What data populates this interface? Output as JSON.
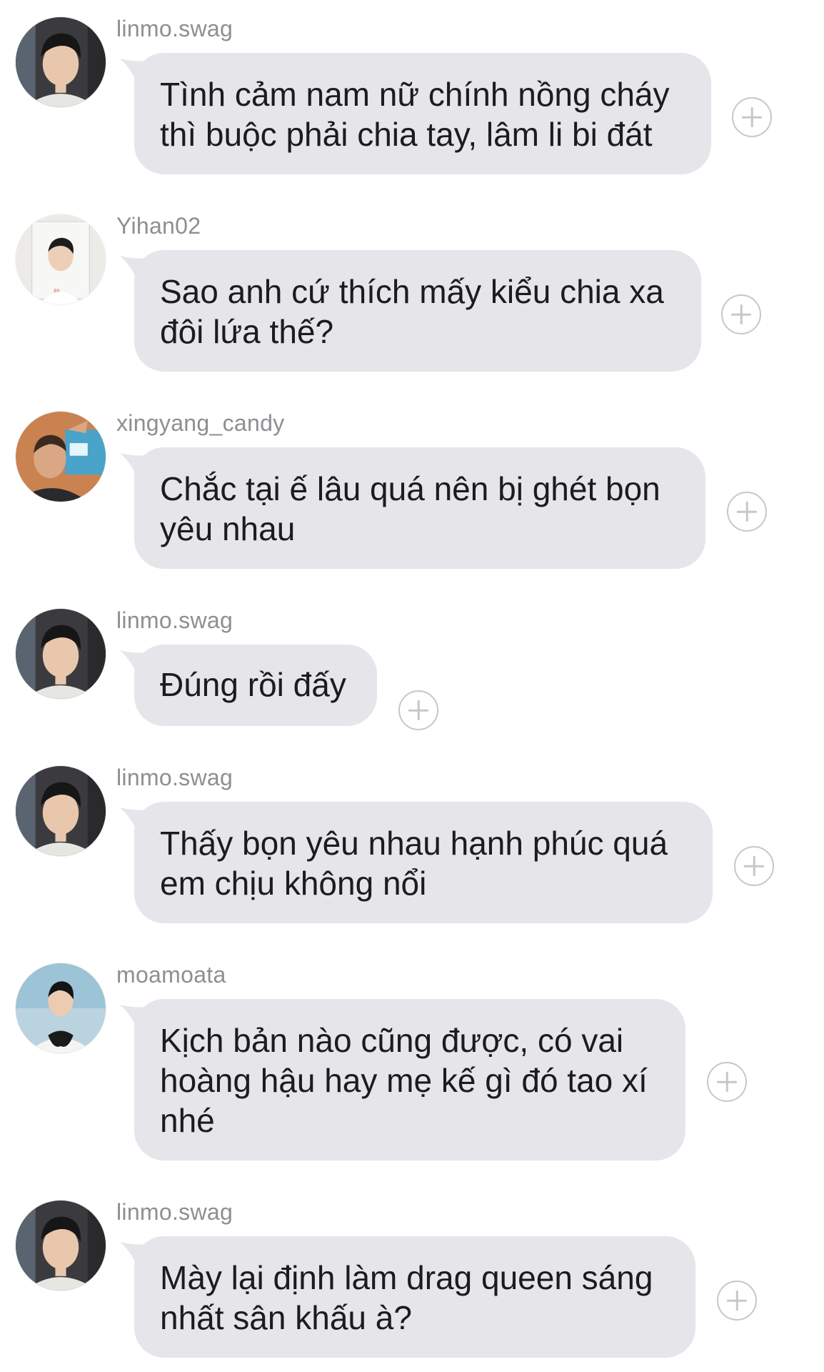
{
  "colors": {
    "bubble": "#e5e5ea",
    "username": "#8e8e93",
    "text": "#1c1c1e",
    "react_icon": "#c7c7cc"
  },
  "messages": [
    {
      "username": "linmo.swag",
      "text": "Tình cảm nam nữ chính nồng cháy thì buộc phải chia tay, lâm li bi đát",
      "avatar": "avatar-linmo"
    },
    {
      "username": "Yihan02",
      "text": "Sao anh cứ thích mấy kiểu chia xa đôi lứa thế?",
      "avatar": "avatar-yihan"
    },
    {
      "username": "xingyang_candy",
      "text": "Chắc tại ế lâu quá nên bị ghét bọn yêu nhau",
      "avatar": "avatar-xingyang"
    },
    {
      "username": "linmo.swag",
      "text": "Đúng rồi đấy",
      "avatar": "avatar-linmo"
    },
    {
      "username": "linmo.swag",
      "text": "Thấy bọn yêu nhau hạnh phúc quá em chịu không nổi",
      "avatar": "avatar-linmo"
    },
    {
      "username": "moamoata",
      "text": "Kịch bản nào cũng được, có vai hoàng hậu hay mẹ kế gì đó tao xí nhé",
      "avatar": "avatar-moamoata"
    },
    {
      "username": "linmo.swag",
      "text": "Mày lại định làm drag queen sáng nhất sân khấu à?",
      "avatar": "avatar-linmo"
    }
  ]
}
